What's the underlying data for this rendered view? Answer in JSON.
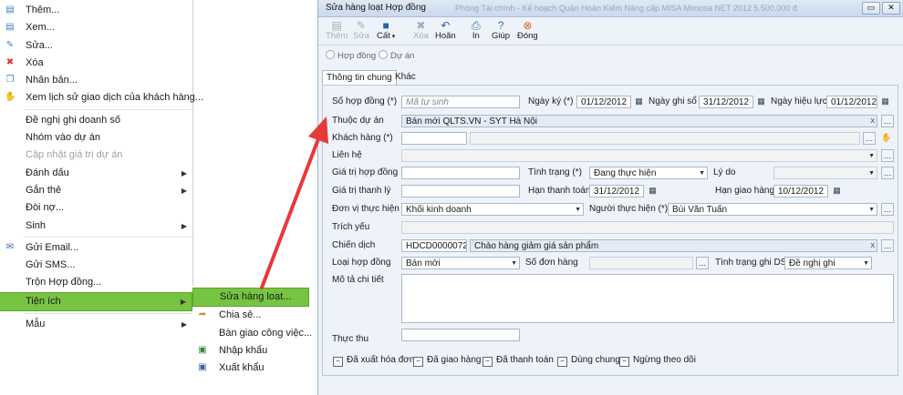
{
  "context_menu": {
    "items": [
      {
        "label": "Thêm...",
        "icon": "add-doc-icon"
      },
      {
        "label": "Xem...",
        "icon": "view-doc-icon"
      },
      {
        "label": "Sửa...",
        "icon": "edit-doc-icon"
      },
      {
        "label": "Xóa",
        "icon": "delete-doc-icon"
      },
      {
        "label": "Nhân bản...",
        "icon": "copy-doc-icon"
      },
      {
        "label": "Xem lịch sử giao dịch của khách hàng...",
        "icon": "handshake-icon"
      },
      {
        "label": "Đề nghị ghi doanh số"
      },
      {
        "label": "Nhóm vào dự án"
      },
      {
        "label": "Cập nhật giá trị dự án"
      },
      {
        "label": "Đánh dấu"
      },
      {
        "label": "Gắn thẻ"
      },
      {
        "label": "Đòi nợ..."
      },
      {
        "label": "Sinh"
      },
      {
        "label": "Gửi Email...",
        "icon": "email-icon"
      },
      {
        "label": "Gửi SMS..."
      },
      {
        "label": "Trộn Hợp đồng..."
      },
      {
        "label": "Tiện ích"
      },
      {
        "label": "Mẫu"
      }
    ],
    "submenu": [
      {
        "label": "Sửa hàng loạt...",
        "icon": ""
      },
      {
        "label": "Chia sẻ...",
        "icon": "share-icon"
      },
      {
        "label": "Bàn giao công việc...",
        "icon": ""
      },
      {
        "label": "Nhập khẩu",
        "icon": "import-icon"
      },
      {
        "label": "Xuất khẩu",
        "icon": "export-icon"
      }
    ]
  },
  "dialog": {
    "title": "Sửa hàng loạt Hợp đồng",
    "title_ghost": "Phòng Tài chính - Kế hoạch Quận Hoàn Kiếm   Nâng cấp MISA Mimosa NET 2012          5.500.000 đ",
    "toolbar": {
      "them": "Thêm",
      "sua": "Sửa",
      "cat": "Cất",
      "xoa": "Xóa",
      "hoan": "Hoãn",
      "in": "In",
      "giup": "Giúp",
      "dong": "Đóng"
    },
    "radio": {
      "hop_dong": "Hợp đồng",
      "du_an": "Dự án"
    },
    "tabs": {
      "general": "Thông tin chung",
      "other": "Khác"
    },
    "fields": {
      "so_hop_dong_label": "Số hợp đồng (*)",
      "so_hop_dong_placeholder": "Mã tự sinh",
      "ngay_ky_label": "Ngày ký (*)",
      "ngay_ky": "01/12/2012",
      "ngay_ghi_so_label": "Ngày ghi sổ",
      "ngay_ghi_so": "31/12/2012",
      "ngay_hieu_luc_label": "Ngày hiệu lực",
      "ngay_hieu_luc": "01/12/2012",
      "thuoc_du_an_label": "Thuộc dự án",
      "thuoc_du_an": "Bán mới QLTS.VN - SYT Hà Nội",
      "khach_hang_label": "Khách hàng (*)",
      "lien_he_label": "Liên hệ",
      "gia_tri_hop_dong_label": "Giá trị hợp đồng",
      "tinh_trang_label": "Tình trạng (*)",
      "tinh_trang": "Đang thực hiện",
      "ly_do_label": "Lý do",
      "gia_tri_thanh_ly_label": "Giá trị thanh lý",
      "han_thanh_toan_label": "Hạn thanh toán",
      "han_thanh_toan": "31/12/2012",
      "han_giao_hang_label": "Hạn giao hàng",
      "han_giao_hang": "10/12/2012",
      "don_vi_label": "Đơn vị thực hiện",
      "don_vi": "Khối kinh doanh",
      "nguoi_thuc_hien_label": "Người thực hiện (*)",
      "nguoi_thuc_hien": "Bùi Văn Tuấn",
      "trich_yeu_label": "Trích yếu",
      "chien_dich_label": "Chiến dịch",
      "chien_dich_code": "HDCD0000072",
      "chien_dich": "Chào hàng giảm giá sản phẩm",
      "loai_hop_dong_label": "Loại hợp đồng",
      "loai_hop_dong": "Bán mới",
      "so_don_hang_label": "Số đơn hàng",
      "tinh_trang_ghi_ds_label": "Tình trạng ghi DS",
      "tinh_trang_ghi_ds": "Đề nghị ghi",
      "mo_ta_label": "Mô tả chi tiết",
      "thuc_thu_label": "Thực thu"
    },
    "checkboxes": [
      "Đã xuất hóa đơn",
      "Đã giao hàng",
      "Đã thanh toán",
      "Dùng chung",
      "Ngừng theo dõi"
    ]
  },
  "colors": {
    "highlight": "#76c442",
    "arrow": "#e63a3a"
  }
}
